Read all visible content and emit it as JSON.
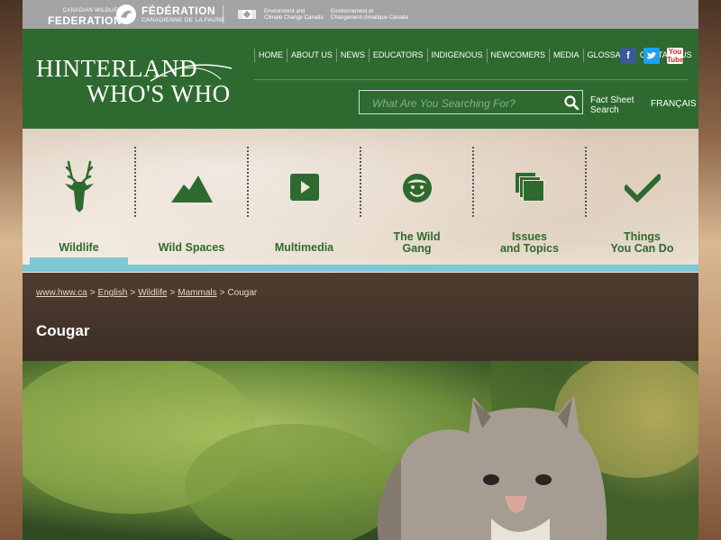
{
  "topbar": {
    "cwf_small": "CANADIAN WILDLIFE",
    "cwf_big": "FEDERATION",
    "fed_big": "FÉDÉRATION",
    "fed_small": "CANADIENNE DE LA FAUNE",
    "eccc_en_1": "Environment and",
    "eccc_en_2": "Climate Change Canada",
    "eccc_fr_1": "Environnement et",
    "eccc_fr_2": "Changement climatique Canada"
  },
  "header": {
    "logo_line1": "HINTERLAND",
    "logo_line2": "WHO'S WHO",
    "nav": [
      "HOME",
      "ABOUT US",
      "NEWS",
      "EDUCATORS",
      "INDIGENOUS",
      "NEWCOMERS",
      "MEDIA",
      "GLOSSARY",
      "CONTACT US"
    ],
    "social_fb": "f",
    "social_yt_1": "You",
    "social_yt_2": "Tube",
    "search_placeholder": "What Are You Searching For?",
    "fact_sheet_1": "Fact Sheet",
    "fact_sheet_2": "Search",
    "language": "FRANÇAIS"
  },
  "categories": [
    {
      "label1": "Wildlife",
      "label2": "",
      "icon": "deer-icon",
      "active": true
    },
    {
      "label1": "Wild Spaces",
      "label2": "",
      "icon": "mountain-icon",
      "active": false
    },
    {
      "label1": "Multimedia",
      "label2": "",
      "icon": "play-icon",
      "active": false
    },
    {
      "label1": "The Wild",
      "label2": "Gang",
      "icon": "face-icon",
      "active": false
    },
    {
      "label1": "Issues",
      "label2": "and Topics",
      "icon": "pages-icon",
      "active": false
    },
    {
      "label1": "Things",
      "label2": "You Can Do",
      "icon": "checkmark-icon",
      "active": false
    }
  ],
  "colors": {
    "brand_green": "#2e6a2f",
    "accent_cyan": "#7ec8d6",
    "topbar_grey": "#a3a3a3"
  },
  "breadcrumb": {
    "items": [
      "www.hww.ca",
      "English",
      "Wildlife",
      "Mammals"
    ],
    "current": "Cougar",
    "separator": ">"
  },
  "page": {
    "title": "Cougar"
  }
}
